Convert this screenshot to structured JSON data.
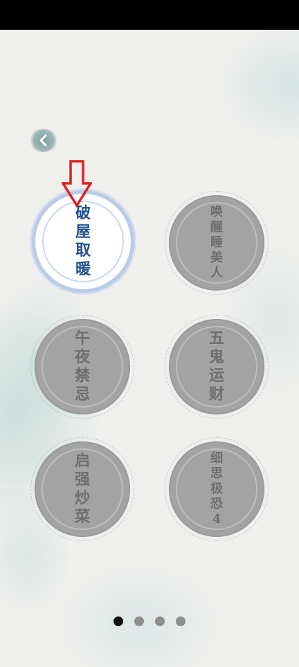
{
  "back_button": {
    "icon": "chevron-left-icon"
  },
  "levels": [
    {
      "id": "level-1",
      "title_chars": [
        "破",
        "屋",
        "取",
        "暖"
      ],
      "state": "active"
    },
    {
      "id": "level-2",
      "title_chars": [
        "唤",
        "醒",
        "睡",
        "美",
        "人"
      ],
      "state": "locked"
    },
    {
      "id": "level-3",
      "title_chars": [
        "午",
        "夜",
        "禁",
        "忌"
      ],
      "state": "locked"
    },
    {
      "id": "level-4",
      "title_chars": [
        "五",
        "鬼",
        "运",
        "财"
      ],
      "state": "locked"
    },
    {
      "id": "level-5",
      "title_chars": [
        "启",
        "强",
        "炒",
        "菜"
      ],
      "state": "locked"
    },
    {
      "id": "level-6",
      "title_chars": [
        "细",
        "思",
        "极",
        "恐",
        "4"
      ],
      "state": "locked"
    }
  ],
  "hint_arrow": {
    "icon": "down-arrow-icon",
    "color": "#e01e1e"
  },
  "pager": {
    "page_count": 4,
    "current_page": 1
  },
  "colors": {
    "active_text": "#214f8f",
    "locked_text": "#6e6e6e",
    "locked_disc": "#a3a3a3",
    "active_ring": "#b9cbe7"
  }
}
